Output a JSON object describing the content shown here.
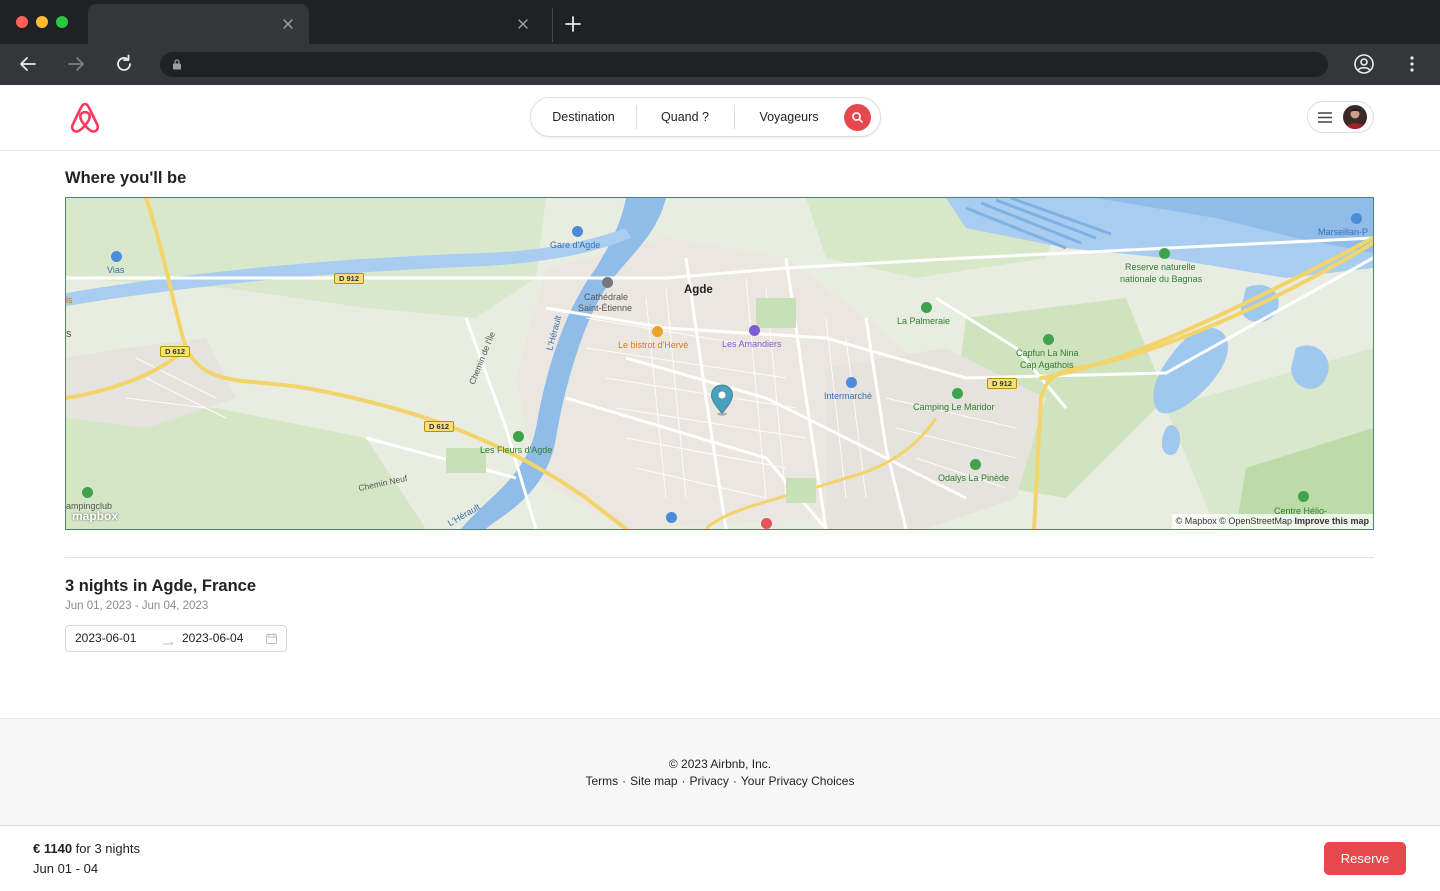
{
  "colors": {
    "brand": "#FF385C",
    "reserve": "#E5484D",
    "map_border": "#4A72D8"
  },
  "header": {
    "search": {
      "destination": "Destination",
      "when": "Quand ?",
      "guests": "Voyageurs"
    }
  },
  "location": {
    "title": "Where you'll be",
    "map": {
      "labels": {
        "agde": "Agde",
        "gare": "Gare d'Agde",
        "vias": "Vias",
        "cathedrale_1": "Cathédrale",
        "cathedrale_2": "Saint-Étienne",
        "bistrot": "Le bistrot d'Hervé",
        "amandiers": "Les Amandiers",
        "palmeraie": "La Palmeraie",
        "reserve_1": "Reserve naturelle",
        "reserve_2": "nationale du Bagnas",
        "marseillan": "Marseillan-P",
        "capfun_1": "Capfun La Nina",
        "capfun_2": "Cap Agathois",
        "intermarche": "Intermarché",
        "camping_maridor": "Camping Le Maridor",
        "fleurs": "Les Fleurs d'Agde",
        "odalys": "Odalys La Pinède",
        "chemin_ile": "Chemin de l'Île",
        "chemin_neuf": "Chemin Neuf",
        "herault": "L'Hérault",
        "herault_2": "L'Hérault",
        "campingclub": "ampingclub",
        "centre_helio": "Centre Hélio-",
        "is": "is",
        "s": "s"
      },
      "roads": {
        "d912_a": "D 912",
        "d612_a": "D 612",
        "d612_b": "D 612",
        "d912_b": "D 912"
      },
      "attribution": {
        "mapbox": "© Mapbox",
        "osm": "© OpenStreetMap",
        "improve": "Improve this map"
      },
      "logo": "mapbox"
    }
  },
  "stay": {
    "title": "3 nights in Agde, France",
    "subtitle": "Jun 01, 2023 - Jun 04, 2023",
    "checkin": "2023-06-01",
    "checkout": "2023-06-04"
  },
  "footer": {
    "copyright": "© 2023 Airbnb, Inc.",
    "links": [
      "Terms",
      "Site map",
      "Privacy",
      "Your Privacy Choices"
    ]
  },
  "booking": {
    "price": "€ 1140",
    "price_suffix": " for 3 nights",
    "dates": "Jun 01 - 04",
    "reserve_label": "Reserve"
  }
}
